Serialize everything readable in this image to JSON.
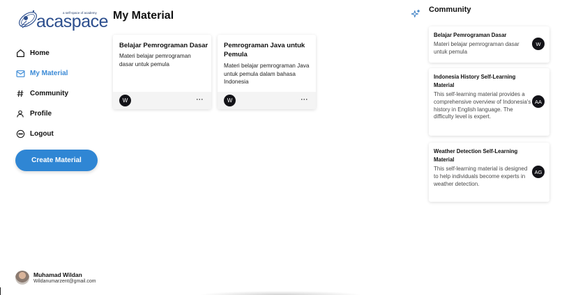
{
  "logo": {
    "text": "acaspace",
    "tagline": "a self-space of academy"
  },
  "nav": {
    "items": [
      {
        "label": "Home",
        "icon": "home-icon"
      },
      {
        "label": "My Material",
        "icon": "mail-icon",
        "active": true
      },
      {
        "label": "Community",
        "icon": "hash-icon"
      },
      {
        "label": "Profile",
        "icon": "user-icon"
      },
      {
        "label": "Logout",
        "icon": "logout-icon"
      }
    ]
  },
  "create_button": {
    "label": "Create Material"
  },
  "user": {
    "name": "Muhamad Wildan",
    "email": "Wildanumarzent@gmail.com"
  },
  "main": {
    "title": "My Material",
    "cards": [
      {
        "title": "Belajar Pemrograman Dasar",
        "description": "Materi belajar pemrograman dasar untuk pemula",
        "avatar": "W",
        "menu": "···"
      },
      {
        "title": "Pemrograman Java untuk Pemula",
        "description": "Materi belajar pemrograman Java untuk pemula dalam bahasa Indonesia",
        "avatar": "W",
        "menu": "···"
      }
    ]
  },
  "community": {
    "title": "Community",
    "icon": "sparkles-icon",
    "cards": [
      {
        "title": "Belajar Pemrograman Dasar",
        "description": "Materi belajar pemrograman dasar untuk pemula",
        "avatar": "W"
      },
      {
        "title": "Indonesia History Self-Learning Material",
        "description": "This self-learning material provides a comprehensive overview of Indonesia's history in English language. The difficulty level is expert.",
        "avatar": "AA"
      },
      {
        "title": "Weather Detection Self-Learning Material",
        "description": "This self-learning material is designed to help individuals become experts in weather detection.",
        "avatar": "AG"
      }
    ]
  },
  "colors": {
    "accent": "#2f86d4",
    "active_nav": "#3b8ad6",
    "avatar_bg": "#131318"
  }
}
